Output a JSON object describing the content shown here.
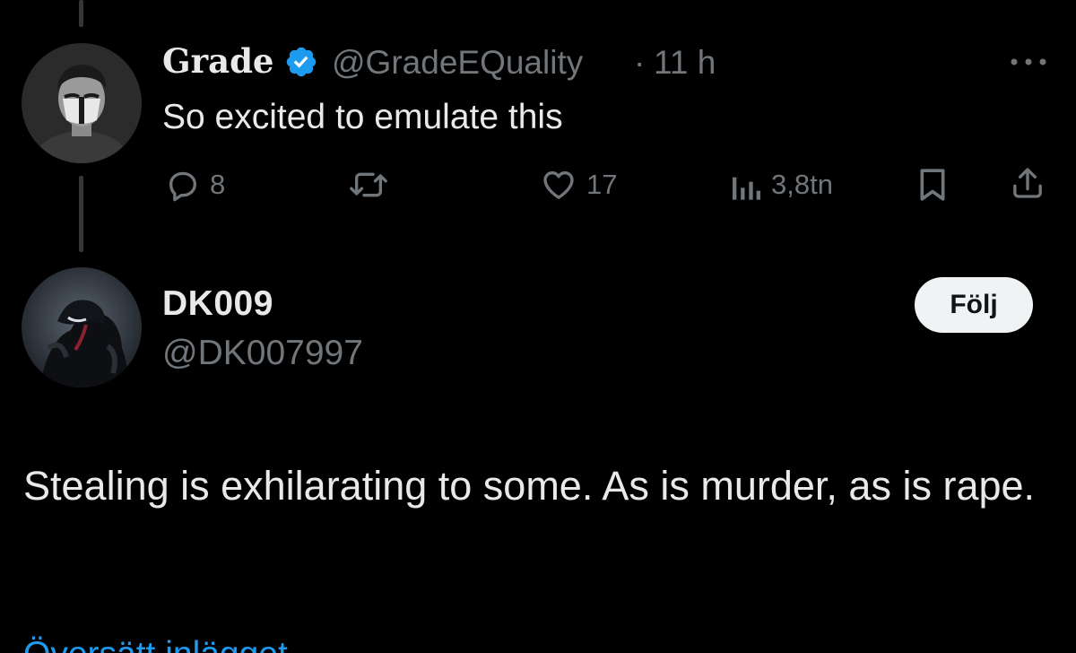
{
  "tweet_parent": {
    "display_name": "Grade",
    "handle": "@GradeEQuality",
    "separator": "·",
    "time": "11 h",
    "text": "So excited to emulate this",
    "actions": {
      "replies": "8",
      "reposts": "",
      "likes": "17",
      "views": "3,8tn"
    },
    "icons": {
      "verified": "verified-badge-icon",
      "more": "more-options-icon",
      "reply": "reply-icon",
      "repost": "repost-icon",
      "like": "heart-icon",
      "views": "views-chart-icon",
      "bookmark": "bookmark-icon",
      "share": "share-icon"
    }
  },
  "tweet_main": {
    "display_name": "DK009",
    "handle": "@DK007997",
    "follow_label": "Följ",
    "text": "Stealing is exhilarating to some. As is murder, as is rape.",
    "translate_label": "Översätt inlägget"
  },
  "colors": {
    "background": "#000000",
    "primary_text": "#e7e9ea",
    "secondary_text": "#71767b",
    "verified_blue": "#1d9bf0",
    "follow_button_bg": "#eff3f4",
    "thread_line": "#333639"
  }
}
